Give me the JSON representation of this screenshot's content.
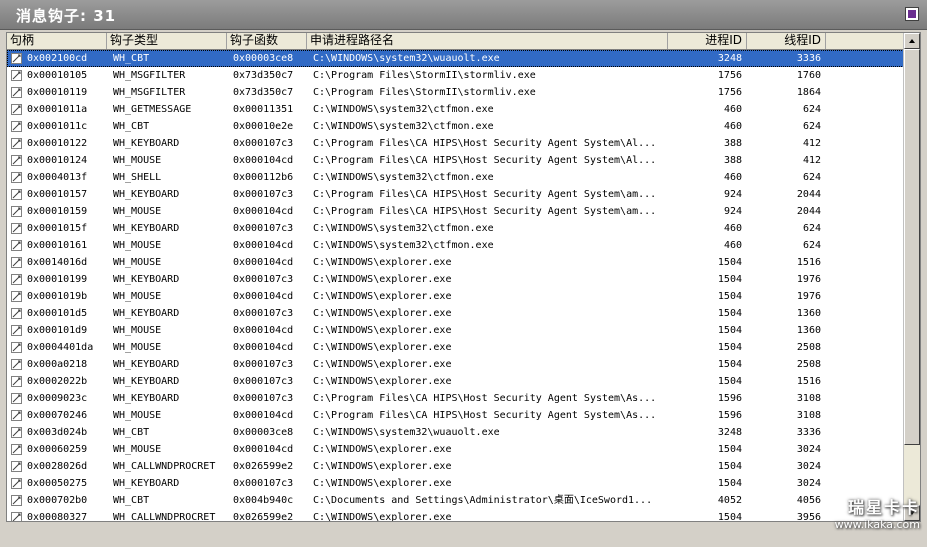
{
  "window": {
    "title": "消息钩子: 31"
  },
  "columns": [
    {
      "label": "句柄"
    },
    {
      "label": "钩子类型"
    },
    {
      "label": "钩子函数"
    },
    {
      "label": "申请进程路径名"
    },
    {
      "label": "进程ID"
    },
    {
      "label": "线程ID"
    }
  ],
  "rows": [
    {
      "handle": "0x002100cd",
      "type": "WH_CBT",
      "func": "0x00003ce8",
      "path": "C:\\WINDOWS\\system32\\wuauolt.exe",
      "pid": "3248",
      "tid": "3336",
      "selected": true
    },
    {
      "handle": "0x00010105",
      "type": "WH_MSGFILTER",
      "func": "0x73d350c7",
      "path": "C:\\Program Files\\StormII\\stormliv.exe",
      "pid": "1756",
      "tid": "1760"
    },
    {
      "handle": "0x00010119",
      "type": "WH_MSGFILTER",
      "func": "0x73d350c7",
      "path": "C:\\Program Files\\StormII\\stormliv.exe",
      "pid": "1756",
      "tid": "1864"
    },
    {
      "handle": "0x0001011a",
      "type": "WH_GETMESSAGE",
      "func": "0x00011351",
      "path": "C:\\WINDOWS\\system32\\ctfmon.exe",
      "pid": "460",
      "tid": "624"
    },
    {
      "handle": "0x0001011c",
      "type": "WH_CBT",
      "func": "0x00010e2e",
      "path": "C:\\WINDOWS\\system32\\ctfmon.exe",
      "pid": "460",
      "tid": "624"
    },
    {
      "handle": "0x00010122",
      "type": "WH_KEYBOARD",
      "func": "0x000107c3",
      "path": "C:\\Program Files\\CA HIPS\\Host Security Agent System\\Al...",
      "pid": "388",
      "tid": "412"
    },
    {
      "handle": "0x00010124",
      "type": "WH_MOUSE",
      "func": "0x000104cd",
      "path": "C:\\Program Files\\CA HIPS\\Host Security Agent System\\Al...",
      "pid": "388",
      "tid": "412"
    },
    {
      "handle": "0x0004013f",
      "type": "WH_SHELL",
      "func": "0x000112b6",
      "path": "C:\\WINDOWS\\system32\\ctfmon.exe",
      "pid": "460",
      "tid": "624"
    },
    {
      "handle": "0x00010157",
      "type": "WH_KEYBOARD",
      "func": "0x000107c3",
      "path": "C:\\Program Files\\CA HIPS\\Host Security Agent System\\am...",
      "pid": "924",
      "tid": "2044"
    },
    {
      "handle": "0x00010159",
      "type": "WH_MOUSE",
      "func": "0x000104cd",
      "path": "C:\\Program Files\\CA HIPS\\Host Security Agent System\\am...",
      "pid": "924",
      "tid": "2044"
    },
    {
      "handle": "0x0001015f",
      "type": "WH_KEYBOARD",
      "func": "0x000107c3",
      "path": "C:\\WINDOWS\\system32\\ctfmon.exe",
      "pid": "460",
      "tid": "624"
    },
    {
      "handle": "0x00010161",
      "type": "WH_MOUSE",
      "func": "0x000104cd",
      "path": "C:\\WINDOWS\\system32\\ctfmon.exe",
      "pid": "460",
      "tid": "624"
    },
    {
      "handle": "0x0014016d",
      "type": "WH_MOUSE",
      "func": "0x000104cd",
      "path": "C:\\WINDOWS\\explorer.exe",
      "pid": "1504",
      "tid": "1516"
    },
    {
      "handle": "0x00010199",
      "type": "WH_KEYBOARD",
      "func": "0x000107c3",
      "path": "C:\\WINDOWS\\explorer.exe",
      "pid": "1504",
      "tid": "1976"
    },
    {
      "handle": "0x0001019b",
      "type": "WH_MOUSE",
      "func": "0x000104cd",
      "path": "C:\\WINDOWS\\explorer.exe",
      "pid": "1504",
      "tid": "1976"
    },
    {
      "handle": "0x000101d5",
      "type": "WH_KEYBOARD",
      "func": "0x000107c3",
      "path": "C:\\WINDOWS\\explorer.exe",
      "pid": "1504",
      "tid": "1360"
    },
    {
      "handle": "0x000101d9",
      "type": "WH_MOUSE",
      "func": "0x000104cd",
      "path": "C:\\WINDOWS\\explorer.exe",
      "pid": "1504",
      "tid": "1360"
    },
    {
      "handle": "0x0004401da",
      "type": "WH_MOUSE",
      "func": "0x000104cd",
      "path": "C:\\WINDOWS\\explorer.exe",
      "pid": "1504",
      "tid": "2508"
    },
    {
      "handle": "0x000a0218",
      "type": "WH_KEYBOARD",
      "func": "0x000107c3",
      "path": "C:\\WINDOWS\\explorer.exe",
      "pid": "1504",
      "tid": "2508"
    },
    {
      "handle": "0x0002022b",
      "type": "WH_KEYBOARD",
      "func": "0x000107c3",
      "path": "C:\\WINDOWS\\explorer.exe",
      "pid": "1504",
      "tid": "1516"
    },
    {
      "handle": "0x0009023c",
      "type": "WH_KEYBOARD",
      "func": "0x000107c3",
      "path": "C:\\Program Files\\CA HIPS\\Host Security Agent System\\As...",
      "pid": "1596",
      "tid": "3108"
    },
    {
      "handle": "0x00070246",
      "type": "WH_MOUSE",
      "func": "0x000104cd",
      "path": "C:\\Program Files\\CA HIPS\\Host Security Agent System\\As...",
      "pid": "1596",
      "tid": "3108"
    },
    {
      "handle": "0x003d024b",
      "type": "WH_CBT",
      "func": "0x00003ce8",
      "path": "C:\\WINDOWS\\system32\\wuauolt.exe",
      "pid": "3248",
      "tid": "3336"
    },
    {
      "handle": "0x00060259",
      "type": "WH_MOUSE",
      "func": "0x000104cd",
      "path": "C:\\WINDOWS\\explorer.exe",
      "pid": "1504",
      "tid": "3024"
    },
    {
      "handle": "0x0028026d",
      "type": "WH_CALLWNDPROCRET",
      "func": "0x026599e2",
      "path": "C:\\WINDOWS\\explorer.exe",
      "pid": "1504",
      "tid": "3024"
    },
    {
      "handle": "0x00050275",
      "type": "WH_KEYBOARD",
      "func": "0x000107c3",
      "path": "C:\\WINDOWS\\explorer.exe",
      "pid": "1504",
      "tid": "3024"
    },
    {
      "handle": "0x000702b0",
      "type": "WH_CBT",
      "func": "0x004b940c",
      "path": "C:\\Documents and Settings\\Administrator\\桌面\\IceSword1...",
      "pid": "4052",
      "tid": "4056"
    },
    {
      "handle": "0x00080327",
      "type": "WH_CALLWNDPROCRET",
      "func": "0x026599e2",
      "path": "C:\\WINDOWS\\explorer.exe",
      "pid": "1504",
      "tid": "3956"
    }
  ],
  "watermark": {
    "logo": "瑞星卡卡",
    "url": "www.ikaka.com"
  },
  "colors": {
    "selection": "#316ac5",
    "titlebar": "#8c8c8c"
  }
}
